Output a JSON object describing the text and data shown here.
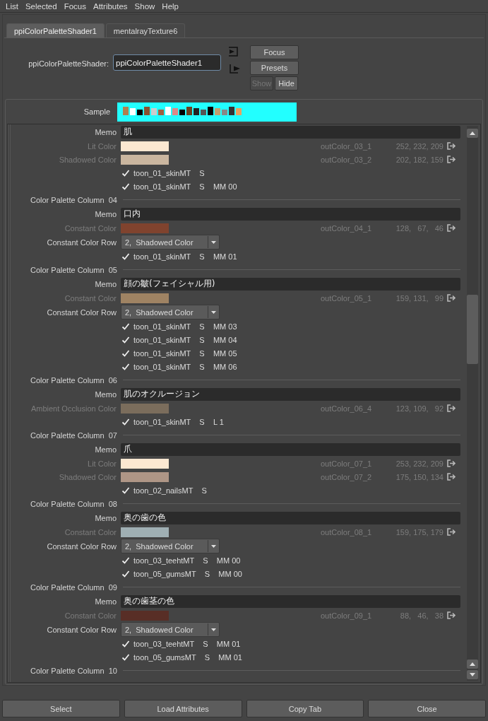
{
  "menu": [
    "List",
    "Selected",
    "Focus",
    "Attributes",
    "Show",
    "Help"
  ],
  "tabs": [
    {
      "label": "ppiColorPaletteShader1",
      "selected": true
    },
    {
      "label": "mentalrayTexture6",
      "selected": false
    }
  ],
  "node": {
    "label": "ppiColorPaletteShader:",
    "value": "ppiColorPaletteShader1"
  },
  "side_buttons": [
    {
      "label": "Focus",
      "disabled": false
    },
    {
      "label": "Presets",
      "disabled": false
    }
  ],
  "toggle_buttons": [
    {
      "label": "Show",
      "disabled": true
    },
    {
      "label": "Hide",
      "disabled": false
    }
  ],
  "sample": {
    "label": "Sample"
  },
  "rows": [
    {
      "kind": "memo",
      "label": "Memo",
      "value": "肌"
    },
    {
      "kind": "color",
      "label": "Lit Color",
      "color": "#fce8d1",
      "output": "outColor_03_1",
      "value": "252, 232, 209"
    },
    {
      "kind": "color",
      "label": "Shadowed Color",
      "color": "#cab69f",
      "output": "outColor_03_2",
      "value": "202, 182, 159"
    },
    {
      "kind": "check",
      "checked": true,
      "label": "toon_01_skinMT",
      "flag": "S"
    },
    {
      "kind": "check",
      "checked": true,
      "label": "toon_01_skinMT",
      "flag": "S",
      "suffix": "MM 00"
    },
    {
      "kind": "header",
      "label": "Color Palette Column  04"
    },
    {
      "kind": "memo",
      "label": "Memo",
      "value": "口内"
    },
    {
      "kind": "color",
      "label": "Constant Color",
      "color": "#80432e",
      "output": "outColor_04_1",
      "value": "128,   67,   46"
    },
    {
      "kind": "dropdown",
      "label": "Constant Color Row",
      "value": "2,  Shadowed Color"
    },
    {
      "kind": "check",
      "checked": true,
      "label": "toon_01_skinMT",
      "flag": "S",
      "suffix": "MM 01"
    },
    {
      "kind": "header",
      "label": "Color Palette Column  05"
    },
    {
      "kind": "memo",
      "label": "Memo",
      "value": "顔の皺(フェイシャル用)"
    },
    {
      "kind": "color",
      "label": "Constant Color",
      "color": "#9f8363",
      "output": "outColor_05_1",
      "value": "159, 131,   99"
    },
    {
      "kind": "dropdown",
      "label": "Constant Color Row",
      "value": "2,  Shadowed Color"
    },
    {
      "kind": "check",
      "checked": true,
      "label": "toon_01_skinMT",
      "flag": "S",
      "suffix": "MM 03"
    },
    {
      "kind": "check",
      "checked": true,
      "label": "toon_01_skinMT",
      "flag": "S",
      "suffix": "MM 04"
    },
    {
      "kind": "check",
      "checked": true,
      "label": "toon_01_skinMT",
      "flag": "S",
      "suffix": "MM 05"
    },
    {
      "kind": "check",
      "checked": true,
      "label": "toon_01_skinMT",
      "flag": "S",
      "suffix": "MM 06"
    },
    {
      "kind": "header",
      "label": "Color Palette Column  06"
    },
    {
      "kind": "memo",
      "label": "Memo",
      "value": "肌のオクルージョン"
    },
    {
      "kind": "color",
      "label": "Ambient Occlusion Color",
      "color": "#7b6d5c",
      "output": "outColor_06_4",
      "value": "123, 109,   92"
    },
    {
      "kind": "check",
      "checked": true,
      "label": "toon_01_skinMT",
      "flag": "S",
      "suffix": "L 1"
    },
    {
      "kind": "header",
      "label": "Color Palette Column  07"
    },
    {
      "kind": "memo",
      "label": "Memo",
      "value": "爪"
    },
    {
      "kind": "color",
      "label": "Lit Color",
      "color": "#fde8d1",
      "output": "outColor_07_1",
      "value": "253, 232, 209"
    },
    {
      "kind": "color",
      "label": "Shadowed Color",
      "color": "#af9686",
      "output": "outColor_07_2",
      "value": "175, 150, 134"
    },
    {
      "kind": "check",
      "checked": true,
      "label": "toon_02_nailsMT",
      "flag": "S"
    },
    {
      "kind": "header",
      "label": "Color Palette Column  08"
    },
    {
      "kind": "memo",
      "label": "Memo",
      "value": "奥の歯の色"
    },
    {
      "kind": "color",
      "label": "Constant Color",
      "color": "#9fafb3",
      "output": "outColor_08_1",
      "value": "159, 175, 179"
    },
    {
      "kind": "dropdown",
      "label": "Constant Color Row",
      "value": "2,  Shadowed Color"
    },
    {
      "kind": "check",
      "checked": true,
      "label": "toon_03_teehtMT",
      "flag": "S",
      "suffix": "MM 00"
    },
    {
      "kind": "check",
      "checked": true,
      "label": "toon_05_gumsMT",
      "flag": "S",
      "suffix": "MM 00"
    },
    {
      "kind": "header",
      "label": "Color Palette Column  09"
    },
    {
      "kind": "memo",
      "label": "Memo",
      "value": "奥の歯茎の色"
    },
    {
      "kind": "color",
      "label": "Constant Color",
      "color": "#582e26",
      "output": "outColor_09_1",
      "value": "88,   46,   38"
    },
    {
      "kind": "dropdown",
      "label": "Constant Color Row",
      "value": "2,  Shadowed Color"
    },
    {
      "kind": "check",
      "checked": true,
      "label": "toon_03_teehtMT",
      "flag": "S",
      "suffix": "MM 01"
    },
    {
      "kind": "check",
      "checked": true,
      "label": "toon_05_gumsMT",
      "flag": "S",
      "suffix": "MM 01"
    },
    {
      "kind": "header",
      "label": "Color Palette Column  10"
    }
  ],
  "bottom_buttons": [
    "Select",
    "Load Attributes",
    "Copy Tab",
    "Close"
  ]
}
